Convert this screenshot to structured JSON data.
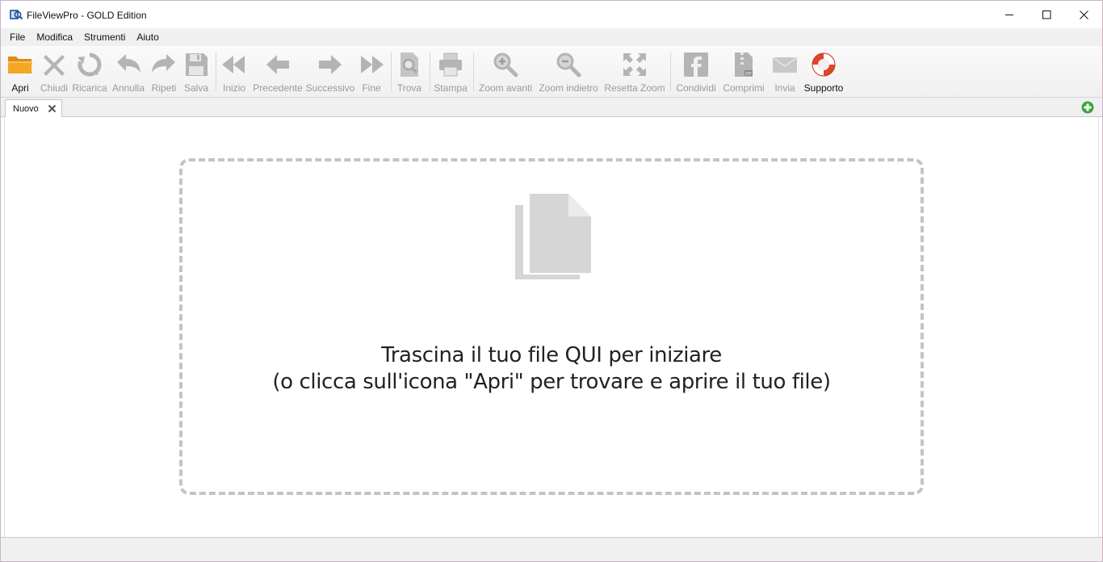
{
  "window": {
    "title": "FileViewPro - GOLD Edition"
  },
  "menu": {
    "items": [
      "File",
      "Modifica",
      "Strumenti",
      "Aiuto"
    ]
  },
  "toolbar": {
    "buttons": [
      {
        "label": "Apri",
        "icon": "folder-open-icon",
        "enabled": true
      },
      {
        "label": "Chiudi",
        "icon": "close-x-icon",
        "enabled": false
      },
      {
        "label": "Ricarica",
        "icon": "reload-icon",
        "enabled": false
      },
      {
        "label": "Annulla",
        "icon": "undo-icon",
        "enabled": false
      },
      {
        "label": "Ripeti",
        "icon": "redo-icon",
        "enabled": false
      },
      {
        "label": "Salva",
        "icon": "floppy-disk-icon",
        "enabled": false
      },
      {
        "label": "Inizio",
        "icon": "rewind-icon",
        "enabled": false
      },
      {
        "label": "Precedente",
        "icon": "arrow-left-icon",
        "enabled": false
      },
      {
        "label": "Successivo",
        "icon": "arrow-right-icon",
        "enabled": false
      },
      {
        "label": "Fine",
        "icon": "fast-forward-icon",
        "enabled": false
      },
      {
        "label": "Trova",
        "icon": "find-document-icon",
        "enabled": false
      },
      {
        "label": "Stampa",
        "icon": "printer-icon",
        "enabled": false
      },
      {
        "label": "Zoom avanti",
        "icon": "zoom-in-icon",
        "enabled": false
      },
      {
        "label": "Zoom indietro",
        "icon": "zoom-out-icon",
        "enabled": false
      },
      {
        "label": "Resetta Zoom",
        "icon": "expand-arrows-icon",
        "enabled": false
      },
      {
        "label": "Condividi",
        "icon": "facebook-icon",
        "enabled": false
      },
      {
        "label": "Comprimi",
        "icon": "zip-archive-icon",
        "enabled": false
      },
      {
        "label": "Invia",
        "icon": "envelope-icon",
        "enabled": false
      },
      {
        "label": "Supporto",
        "icon": "lifebuoy-icon",
        "enabled": true
      }
    ]
  },
  "tabs": [
    {
      "label": "Nuovo"
    }
  ],
  "dropzone": {
    "line1": "Trascina il tuo file QUI per iniziare",
    "line2": "(o clicca sull'icona \"Apri\" per trovare e aprire il tuo file)"
  },
  "colors": {
    "accent_orange": "#f0a020",
    "disabled_icon": "#b4b4b4",
    "dropzone_border": "#c4c4c4",
    "add_tab_green": "#3aa53a",
    "lifebuoy_red": "#e0452a"
  }
}
